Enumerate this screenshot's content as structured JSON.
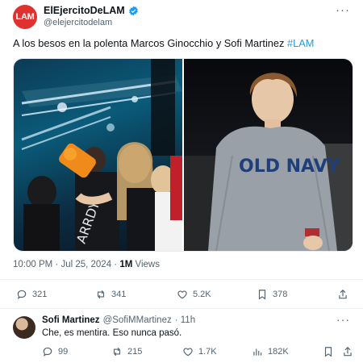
{
  "tweet": {
    "avatar_text": "LAM",
    "display_name": "ElEjercitoDeLAM",
    "handle": "@elejercitodelam",
    "text_main": "A los besos en la polenta Marcos Ginocchio y Sofi Martinez ",
    "hashtag": "#LAM",
    "time": "10:00 PM · Jul 25, 2024 · ",
    "views_count": "1M",
    "views_label": " Views",
    "stats": {
      "replies": "321",
      "reposts": "341",
      "likes": "5.2K",
      "bookmarks": "378"
    }
  },
  "reply": {
    "display_name": "Sofi Martinez",
    "handle": "@SofiMMartinez",
    "time": "· 11h",
    "text": "Che, es mentira. Eso nunca pasó.",
    "stats": {
      "replies": "99",
      "reposts": "215",
      "likes": "1.7K",
      "views": "182K"
    }
  },
  "photo_text": {
    "shirt_brand": "OLD NAVY"
  },
  "colors": {
    "accent": "#1d9bf0",
    "avatar_bg": "#e03131",
    "muted": "#536471"
  }
}
